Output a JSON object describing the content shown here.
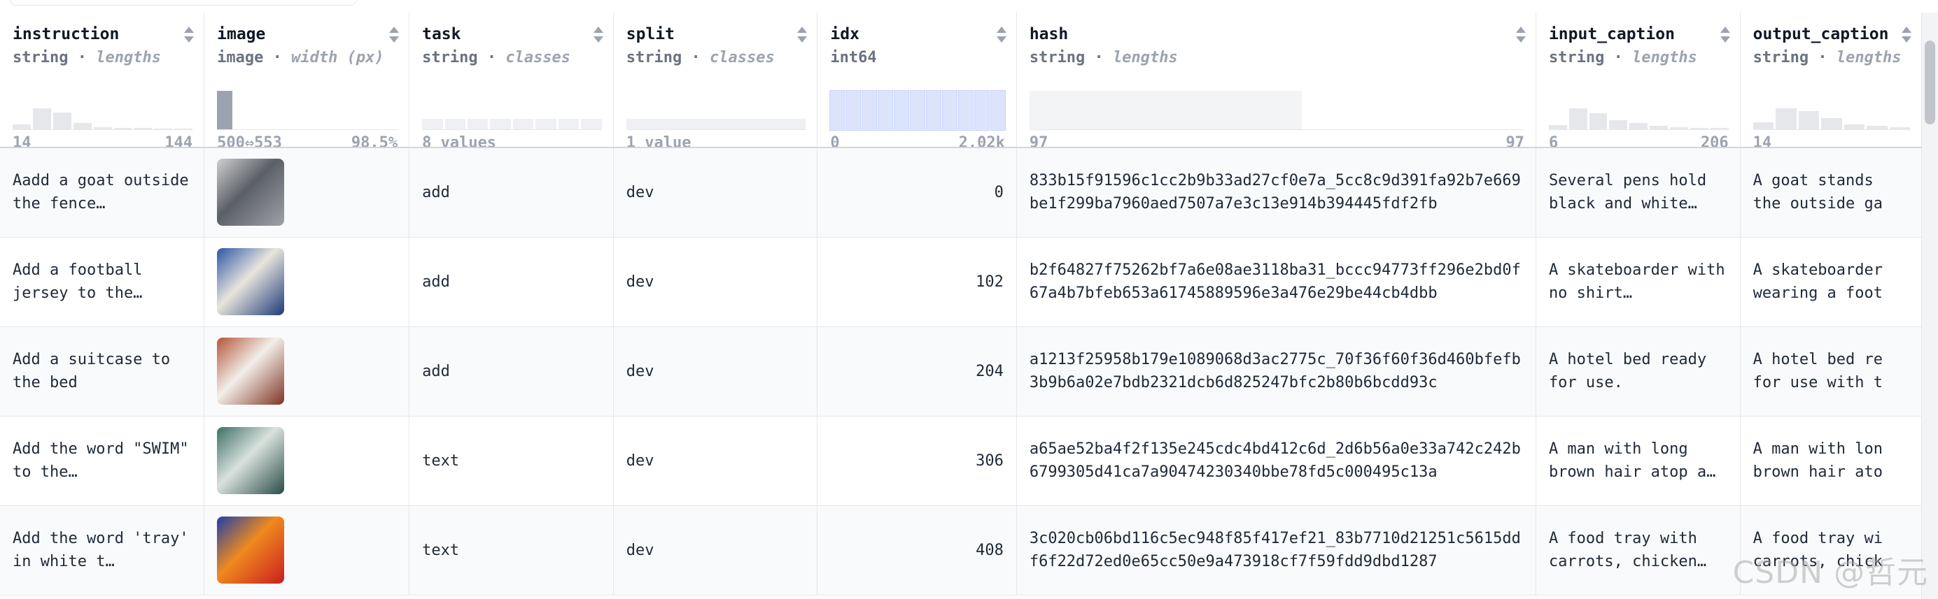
{
  "columns": [
    {
      "name": "instruction",
      "type": "string",
      "stat": "lengths",
      "min": "14",
      "max": "144"
    },
    {
      "name": "image",
      "type": "image",
      "stat": "width (px)",
      "min": "500⇔553",
      "max": "98.5%"
    },
    {
      "name": "task",
      "type": "string",
      "stat": "classes",
      "min": "8 values",
      "max": ""
    },
    {
      "name": "split",
      "type": "string",
      "stat": "classes",
      "min": "1 value",
      "max": ""
    },
    {
      "name": "idx",
      "type": "int64",
      "stat": "",
      "min": "0",
      "max": "2.02k"
    },
    {
      "name": "hash",
      "type": "string",
      "stat": "lengths",
      "min": "97",
      "max": "97"
    },
    {
      "name": "input_caption",
      "type": "string",
      "stat": "lengths",
      "min": "6",
      "max": "206"
    },
    {
      "name": "output_caption",
      "type": "string",
      "stat": "lengths",
      "min": "14",
      "max": ""
    }
  ],
  "histograms": {
    "instruction": [
      0.15,
      0.55,
      0.45,
      0.18,
      0.08,
      0.06,
      0.05,
      0.04,
      0.03
    ],
    "image": [
      1.0
    ],
    "task": [
      0.25,
      0.25,
      0.25,
      0.25,
      0.25,
      0.25,
      0.25,
      0.25
    ],
    "split": [
      0.25
    ],
    "idx": [
      1,
      1,
      1,
      1,
      1,
      1,
      1,
      1,
      1,
      1,
      1
    ],
    "hash": [
      1.0
    ],
    "input_caption": [
      0.12,
      0.55,
      0.42,
      0.25,
      0.18,
      0.1,
      0.08,
      0.06,
      0.05
    ],
    "output_caption": [
      0.2,
      0.55,
      0.48,
      0.3,
      0.15,
      0.1,
      0.08
    ]
  },
  "rows": [
    {
      "instruction": "Aadd a goat outside the fence…",
      "task": "add",
      "split": "dev",
      "idx": "0",
      "hash": "833b15f91596c1cc2b9b33ad27cf0e7a_5cc8c9d391fa92b7e669be1f299ba7960aed7507a7e3c13e914b394445fdf2fb",
      "input_caption": "Several pens hold black and white…",
      "output_caption": "A goat stands the outside ga",
      "thumb_colors": [
        "#cfcfcf",
        "#5b5f66",
        "#9fa3a8"
      ]
    },
    {
      "instruction": "Add a football jersey to the…",
      "task": "add",
      "split": "dev",
      "idx": "102",
      "hash": "b2f64827f75262bf7a6e08ae3118ba31_bccc94773ff296e2bd0f67a4b7bfeb653a61745889596e3a476e29be44cb4dbb",
      "input_caption": "A skateboarder with no shirt…",
      "output_caption": "A skateboarder wearing a foot",
      "thumb_colors": [
        "#2b56a6",
        "#e9e5dc",
        "#1c3a78"
      ]
    },
    {
      "instruction": "Add a suitcase to the bed",
      "task": "add",
      "split": "dev",
      "idx": "204",
      "hash": "a1213f25958b179e1089068d3ac2775c_70f36f60f36d460bfefb3b9b6a02e7bdb2321dcb6d825247bfc2b80b6bcdd93c",
      "input_caption": "A hotel bed ready for use.",
      "output_caption": "A hotel bed re for use with t",
      "thumb_colors": [
        "#b4553a",
        "#f3efe9",
        "#7d3424"
      ]
    },
    {
      "instruction": "Add the word \"SWIM\" to the…",
      "task": "text",
      "split": "dev",
      "idx": "306",
      "hash": "a65ae52ba4f2f135e245cdc4bd412c6d_2d6b56a0e33a742c242b6799305d41ca7a90474230340bbe78fd5c000495c13a",
      "input_caption": "A man with long brown hair atop a…",
      "output_caption": "A man with lon brown hair ato",
      "thumb_colors": [
        "#3e6e68",
        "#d9e2dd",
        "#2a4c48"
      ]
    },
    {
      "instruction": "Add the word 'tray' in white t…",
      "task": "text",
      "split": "dev",
      "idx": "408",
      "hash": "3c020cb06bd116c5ec948f85f417ef21_83b7710d21251c5615ddf6f22d72ed0e65cc50e9a473918cf7f59fdd9dbd1287",
      "input_caption": "A food tray with carrots, chicken…",
      "output_caption": "A food tray wi carrots, chick",
      "thumb_colors": [
        "#1f3fa8",
        "#f08a1e",
        "#c91e1e"
      ]
    }
  ],
  "colors": {
    "idx_bar": "#dbe4fb",
    "idx_bar_border": "#c7d2fe",
    "image_bar": "#9ca3af",
    "light_bar": "#f3f4f6"
  },
  "watermark": "CSDN @哲元"
}
